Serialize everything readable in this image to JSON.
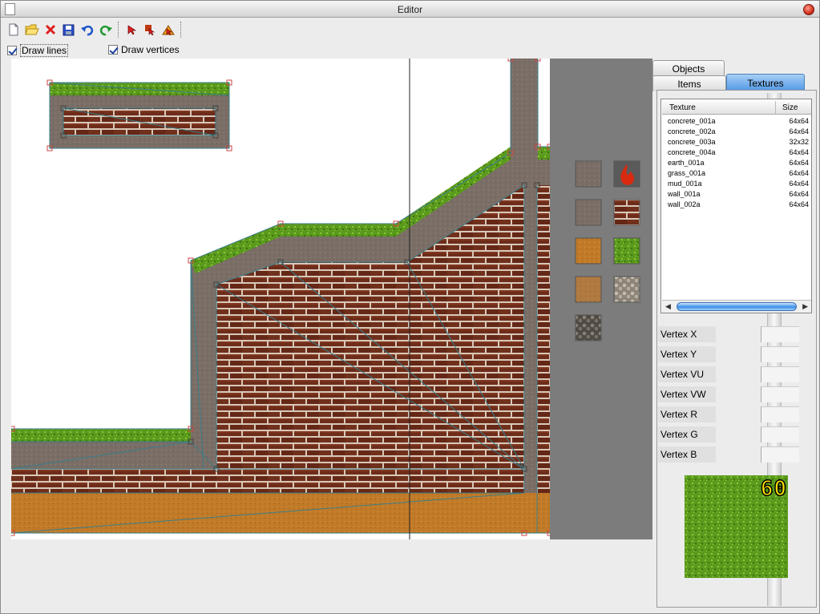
{
  "window": {
    "title": "Editor"
  },
  "toolbar": {
    "buttons": [
      "new-icon",
      "open-folder-icon",
      "delete-icon",
      "save-icon",
      "undo-icon",
      "redo-icon",
      "select-arrow-icon",
      "select-vertex-icon",
      "select-polygon-icon"
    ]
  },
  "options": {
    "draw_lines": {
      "label": "Draw lines",
      "checked": true
    },
    "draw_vertices": {
      "label": "Draw vertices",
      "checked": true
    }
  },
  "tabs": {
    "objects": "Objects",
    "items": "Items",
    "textures": "Textures",
    "active": "Textures"
  },
  "texture_list": {
    "columns": [
      "Texture",
      "Size"
    ],
    "rows": [
      {
        "name": "concrete_001a",
        "size": "64x64"
      },
      {
        "name": "concrete_002a",
        "size": "64x64"
      },
      {
        "name": "concrete_003a",
        "size": "32x32"
      },
      {
        "name": "concrete_004a",
        "size": "64x64"
      },
      {
        "name": "earth_001a",
        "size": "64x64"
      },
      {
        "name": "grass_001a",
        "size": "64x64"
      },
      {
        "name": "mud_001a",
        "size": "64x64"
      },
      {
        "name": "wall_001a",
        "size": "64x64"
      },
      {
        "name": "wall_002a",
        "size": "64x64"
      }
    ]
  },
  "vertex_fields": {
    "x": {
      "label": "Vertex X",
      "value": ""
    },
    "y": {
      "label": "Vertex Y",
      "value": ""
    },
    "vu": {
      "label": "Vertex VU",
      "value": ""
    },
    "vw": {
      "label": "Vertex VW",
      "value": ""
    },
    "r": {
      "label": "Vertex R",
      "value": ""
    },
    "g": {
      "label": "Vertex G",
      "value": ""
    },
    "b": {
      "label": "Vertex B",
      "value": ""
    }
  },
  "preview": {
    "fps": "60",
    "texture": "grass"
  },
  "palette": {
    "swatches": [
      "concrete-gray",
      "fire",
      "concrete-dark",
      "brick",
      "earth-orange",
      "grass-green",
      "mud",
      "cobble-light",
      "cobble-dark"
    ]
  },
  "colors": {
    "grass": "#5f9e1e",
    "brick": "#6b2a1a",
    "mortar": "#c8b8a8",
    "concrete": "#7d7268",
    "earth": "#c47a25",
    "edge": "#3a7e8a",
    "vertex": "#d06060",
    "palette_bg": "#7c7c7c",
    "tab_active": "#4f95e6"
  }
}
